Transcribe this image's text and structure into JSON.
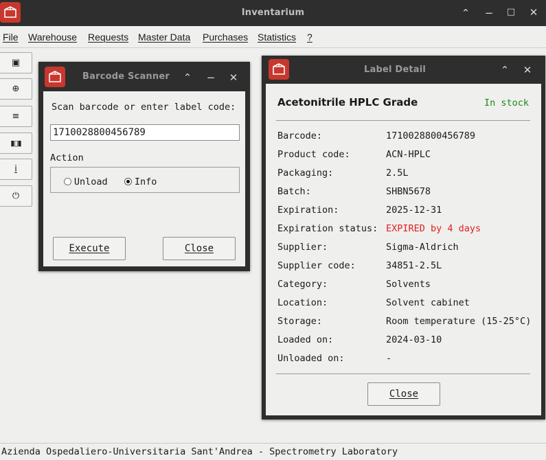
{
  "app": {
    "title": "Inventarium",
    "brand_color": "#c8372d",
    "icon": "app-box-icon"
  },
  "window_controls": {
    "maximize_up": "⌃",
    "minimize": "−",
    "restore": "□",
    "close": "✕"
  },
  "menu": {
    "items": [
      {
        "label": "File"
      },
      {
        "label": "Warehouse"
      },
      {
        "label": "Requests"
      },
      {
        "label": "Master Data"
      },
      {
        "label": "Purchases"
      },
      {
        "label": "Statistics"
      },
      {
        "label": "?"
      }
    ]
  },
  "toolbar": {
    "buttons": [
      {
        "glyph": "▣",
        "icon": "scan-square-icon"
      },
      {
        "glyph": "⊕",
        "icon": "add-circle-icon"
      },
      {
        "glyph": "≡",
        "icon": "list-icon"
      },
      {
        "glyph": "▮▯▮",
        "icon": "barcode-icon"
      },
      {
        "glyph": "i",
        "icon": "info-icon"
      },
      {
        "glyph": "⏻",
        "icon": "power-icon"
      }
    ]
  },
  "scanner": {
    "title": "Barcode Scanner",
    "prompt": "Scan barcode or enter label code:",
    "code_value": "1710028800456789",
    "action_label": "Action",
    "options": [
      {
        "label": "Unload",
        "selected": false
      },
      {
        "label": "Info",
        "selected": true
      }
    ],
    "execute_label": "Execute",
    "close_label": "Close"
  },
  "detail": {
    "title": "Label Detail",
    "product_name": "Acetonitrile HPLC Grade",
    "stock_status": "In stock",
    "stock_color": "#1a8a1a",
    "expired_color": "#e02020",
    "fields": [
      {
        "label": "Barcode:",
        "value": "1710028800456789"
      },
      {
        "label": "Product code:",
        "value": "ACN-HPLC"
      },
      {
        "label": "Packaging:",
        "value": "2.5L"
      },
      {
        "label": "Batch:",
        "value": "SHBN5678"
      },
      {
        "label": "Expiration:",
        "value": "2025-12-31"
      },
      {
        "label": "Expiration status:",
        "value": "EXPIRED by 4 days"
      },
      {
        "label": "Supplier:",
        "value": "Sigma-Aldrich"
      },
      {
        "label": "Supplier code:",
        "value": "34851-2.5L"
      },
      {
        "label": "Category:",
        "value": "Solvents"
      },
      {
        "label": "Location:",
        "value": "Solvent cabinet"
      },
      {
        "label": "Storage:",
        "value": "Room temperature (15-25°C)"
      },
      {
        "label": "Loaded on:",
        "value": "2024-03-10"
      },
      {
        "label": "Unloaded on:",
        "value": "-"
      }
    ],
    "close_label": "Close"
  },
  "status_bar": {
    "text": "Azienda Ospedaliero-Universitaria Sant'Andrea - Spectrometry Laboratory"
  }
}
